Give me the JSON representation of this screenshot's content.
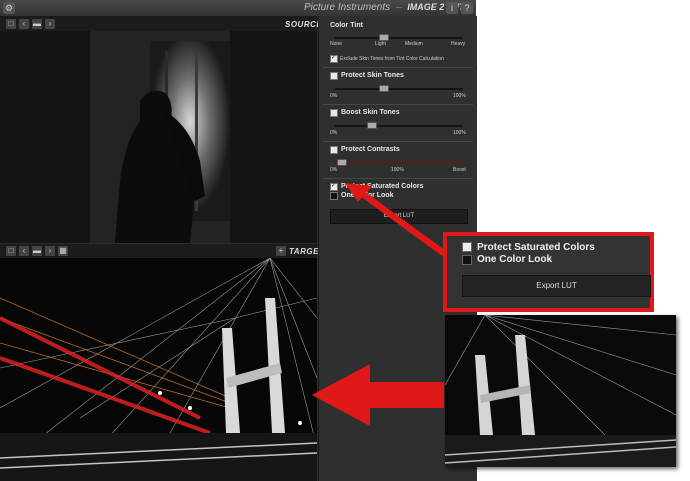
{
  "app": {
    "title": "Picture Instruments",
    "separator": "–",
    "subtitle": "IMAGE 2 LUT",
    "info_label": "i",
    "help_label": "?"
  },
  "source": {
    "label": "SOURCE"
  },
  "target": {
    "label": "TARGET",
    "add_label": "+"
  },
  "sidebar": {
    "color_tint": {
      "title": "Color Tint",
      "labels": [
        "None",
        "Light",
        "Medium",
        "Heavy"
      ],
      "value_fraction": 0.33,
      "exclude_label": "Exclude Skin Tones from Tint Color Calculation",
      "exclude_checked": true
    },
    "protect_skin": {
      "title": "Protect Skin Tones",
      "checked": false,
      "min": "0%",
      "max": "100%",
      "value_fraction": 0.36
    },
    "boost_skin": {
      "title": "Boost Skin Tones",
      "checked": false,
      "min": "0%",
      "max": "100%",
      "value_fraction": 0.36
    },
    "protect_contrasts": {
      "title": "Protect Contrasts",
      "checked": false,
      "min": "0%",
      "mid": "100%",
      "max": "Boost",
      "value_fraction": 0.05
    },
    "protect_saturated": {
      "title": "Protect Saturated Colors",
      "checked": true
    },
    "one_color": {
      "title": "One Color Look",
      "checked": false
    },
    "export_label": "Export LUT"
  },
  "callout": {
    "line1": "Protect Saturated Colors",
    "line2": "One Color Look",
    "export_label": "Export LUT"
  },
  "colors": {
    "accent_red": "#e01818",
    "panel": "#2f2f2f"
  }
}
